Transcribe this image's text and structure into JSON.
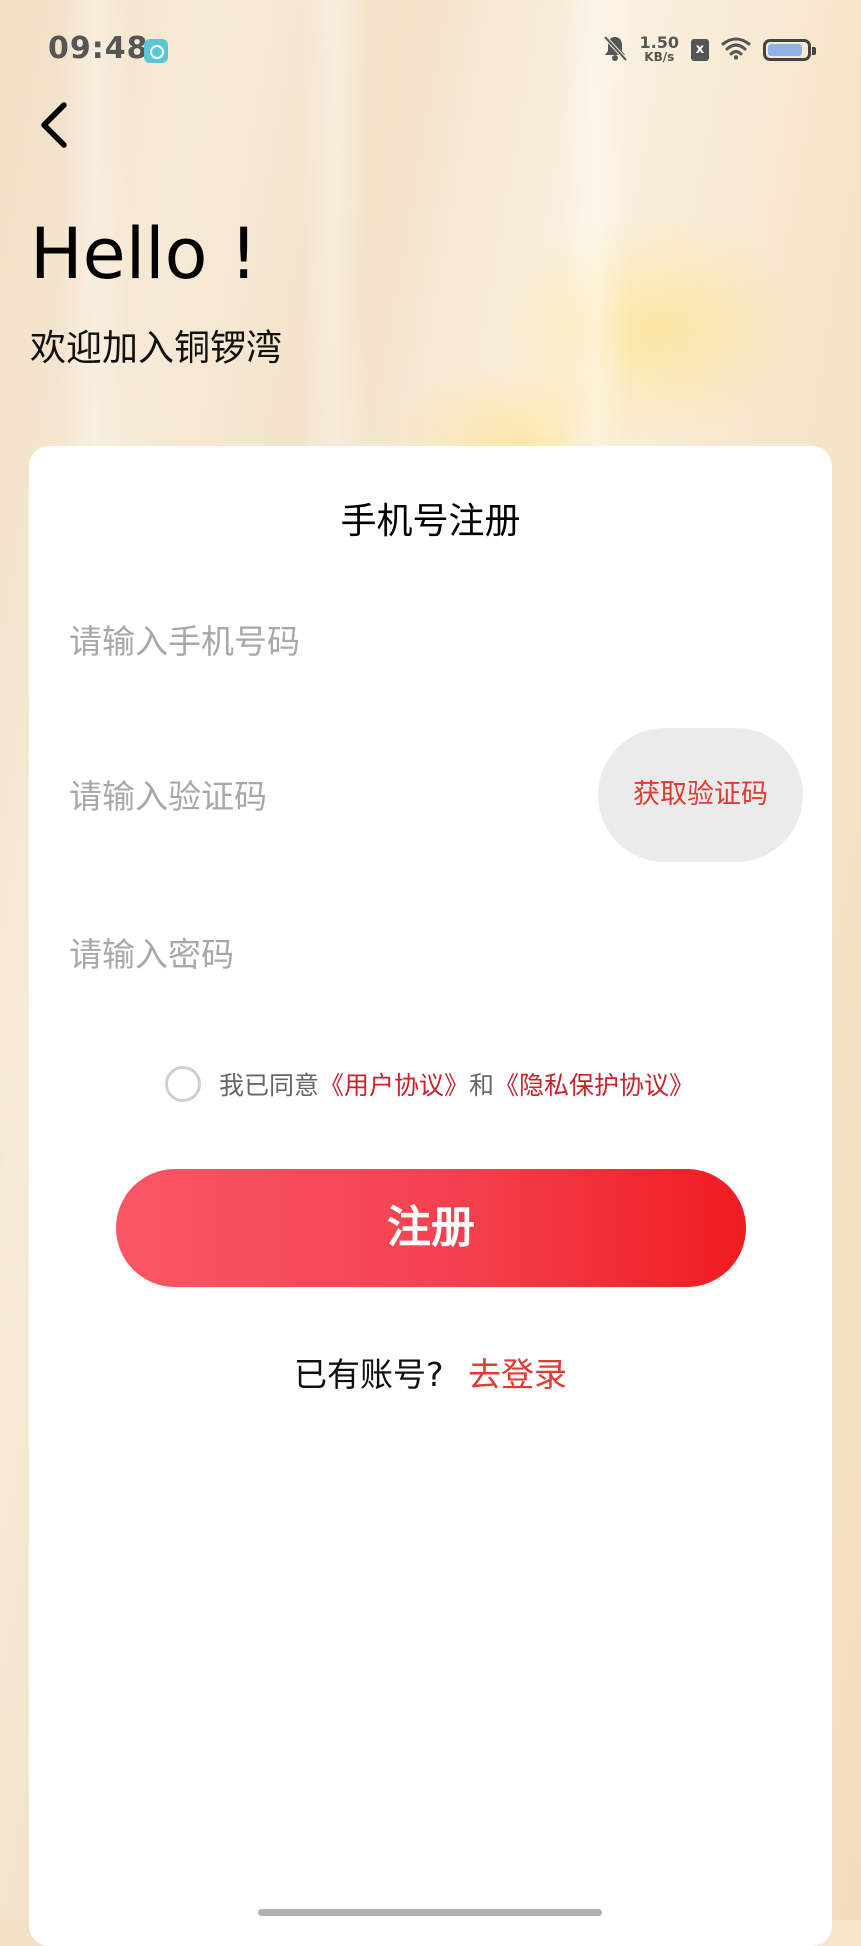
{
  "status_bar": {
    "time": "09:48",
    "net_speed_value": "1.50",
    "net_speed_unit": "KB/s",
    "sim_label": "x",
    "battery_level": 0.9,
    "app_icon": "camera-app-icon",
    "icons": [
      "bell-off-icon",
      "sim-card-icon",
      "wifi-icon",
      "battery-icon"
    ]
  },
  "header": {
    "back_icon": "chevron-left-icon",
    "greeting": "Hello !",
    "welcome": "欢迎加入铜锣湾"
  },
  "form": {
    "title": "手机号注册",
    "phone_placeholder": "请输入手机号码",
    "code_placeholder": "请输入验证码",
    "get_code_label": "获取验证码",
    "password_placeholder": "请输入密码",
    "agree_prefix": "我已同意",
    "user_agreement": "《用户协议》",
    "and": "和",
    "privacy_agreement": "《隐私保护协议》",
    "register_label": "注册",
    "has_account": "已有账号?",
    "go_login": "去登录"
  },
  "colors": {
    "accent": "#e03a32",
    "register_gradient_start": "#fa5664",
    "register_gradient_end": "#ef1c20",
    "link": "#c8232c"
  }
}
